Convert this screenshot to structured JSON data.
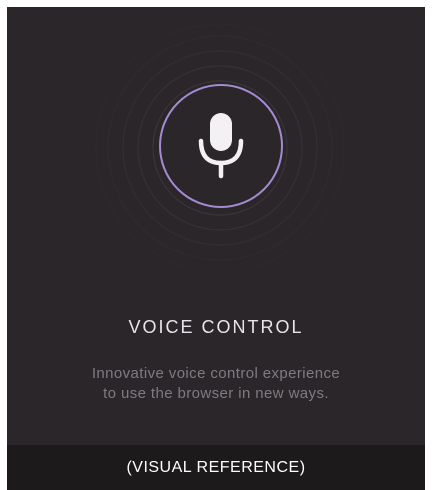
{
  "feature": {
    "title": "VOICE CONTROL",
    "description_line1": "Innovative voice control experience",
    "description_line2": "to use the browser in new ways."
  },
  "icon": {
    "name": "microphone-icon"
  },
  "colors": {
    "background": "#2a2629",
    "accent_ring": "#a48bd1",
    "title_text": "#e9e4ea",
    "body_text": "#807a83",
    "footer_background": "#1d1a1c",
    "footer_text": "#ffffff"
  },
  "footer": {
    "label": "(VISUAL REFERENCE)"
  }
}
